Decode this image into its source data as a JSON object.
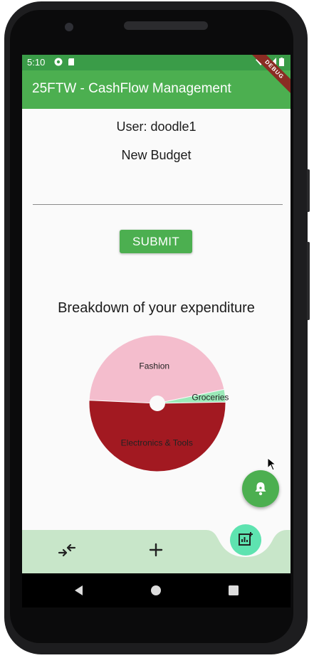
{
  "status_bar": {
    "time": "5:10"
  },
  "app_bar": {
    "title": "25FTW - CashFlow Management",
    "debug_label": "DEBUG"
  },
  "content": {
    "user_label": "User: doodle1",
    "new_budget_label": "New Budget",
    "budget_input": {
      "value": "",
      "placeholder": ""
    },
    "submit_label": "SUBMIT",
    "breakdown_title": "Breakdown of your expenditure"
  },
  "chart_data": {
    "type": "pie",
    "title": "Breakdown of your expenditure",
    "categories": [
      "Fashion",
      "Groceries",
      "Electronics & Tools"
    ],
    "values": [
      46,
      3,
      51
    ],
    "colors": [
      "#f4bdcd",
      "#9be9b8",
      "#a21921"
    ],
    "hole": true
  },
  "fab": {
    "bell_icon": "bell-icon",
    "add_chart_icon": "add-chart-icon"
  },
  "bottom_bar": {
    "left_icon": "swap-arrows-icon",
    "center_icon": "plus-icon",
    "bg_color": "#c8e6c9"
  },
  "nav_bar": {
    "back": "back-icon",
    "home": "home-icon",
    "recents": "recents-icon"
  }
}
